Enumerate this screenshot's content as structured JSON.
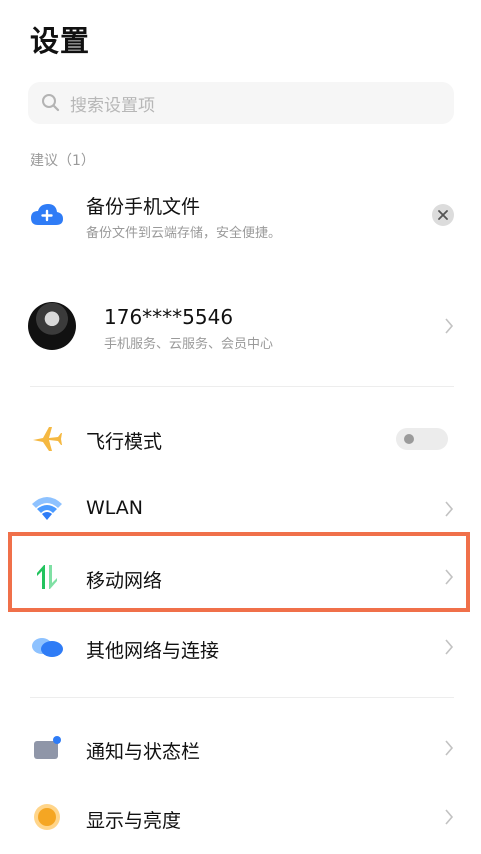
{
  "header": {
    "title": "设置"
  },
  "search": {
    "placeholder": "搜索设置项"
  },
  "suggestions": {
    "label": "建议（1）",
    "item": {
      "title": "备份手机文件",
      "subtitle": "备份文件到云端存储，安全便捷。",
      "icon": "cloud-plus-icon"
    }
  },
  "account": {
    "phone": "176****5546",
    "subtitle": "手机服务、云服务、会员中心"
  },
  "items": [
    {
      "id": "airplane",
      "label": "飞行模式",
      "icon": "airplane-icon",
      "control": "toggle",
      "enabled": false
    },
    {
      "id": "wlan",
      "label": "WLAN",
      "icon": "wifi-icon",
      "control": "chevron"
    },
    {
      "id": "mobile-network",
      "label": "移动网络",
      "icon": "mobile-data-icon",
      "control": "chevron",
      "highlighted": true
    },
    {
      "id": "other-network",
      "label": "其他网络与连接",
      "icon": "cloud-link-icon",
      "control": "chevron"
    },
    {
      "id": "notification",
      "label": "通知与状态栏",
      "icon": "notification-icon",
      "control": "chevron"
    },
    {
      "id": "display",
      "label": "显示与亮度",
      "icon": "brightness-icon",
      "control": "chevron"
    }
  ],
  "colors": {
    "highlight": "#f0704a",
    "accent_blue": "#2f7cf6",
    "mobile_green": "#22c35e"
  }
}
